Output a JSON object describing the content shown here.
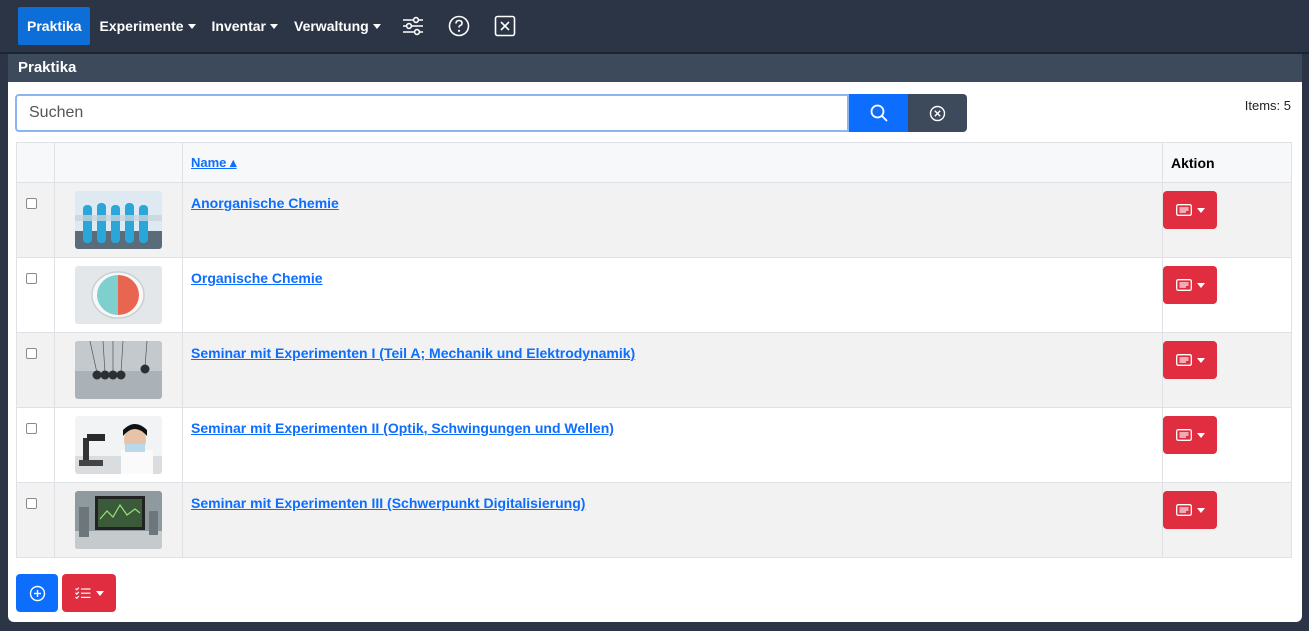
{
  "navbar": {
    "items": [
      {
        "label": "Praktika",
        "active": true,
        "has_caret": false
      },
      {
        "label": "Experimente",
        "active": false,
        "has_caret": true
      },
      {
        "label": "Inventar",
        "active": false,
        "has_caret": true
      },
      {
        "label": "Verwaltung",
        "active": false,
        "has_caret": true
      }
    ],
    "icons": [
      "sliders-icon",
      "help-circle-icon",
      "close-square-icon"
    ]
  },
  "subheader": {
    "title": "Praktika"
  },
  "search": {
    "placeholder": "Suchen",
    "value": ""
  },
  "items_count": "Items: 5",
  "table": {
    "columns": {
      "name": "Name ▴",
      "action": "Aktion"
    },
    "rows": [
      {
        "name": "Anorganische Chemie",
        "thumbnail": "test-tubes-image"
      },
      {
        "name": "Organische Chemie",
        "thumbnail": "petri-dish-image"
      },
      {
        "name": "Seminar mit Experimenten I (Teil A; Mechanik und Elektrodynamik)",
        "thumbnail": "newtons-cradle-image"
      },
      {
        "name": "Seminar mit Experimenten II (Optik, Schwingungen und Wellen)",
        "thumbnail": "microscope-scientist-image"
      },
      {
        "name": "Seminar mit Experimenten III (Schwerpunkt Digitalisierung)",
        "thumbnail": "lab-monitor-image"
      }
    ]
  },
  "colors": {
    "navbar_bg": "#2b3545",
    "accent_blue": "#0d6efd",
    "action_red": "#e02d3f",
    "clear_btn": "#3d4a5c"
  }
}
